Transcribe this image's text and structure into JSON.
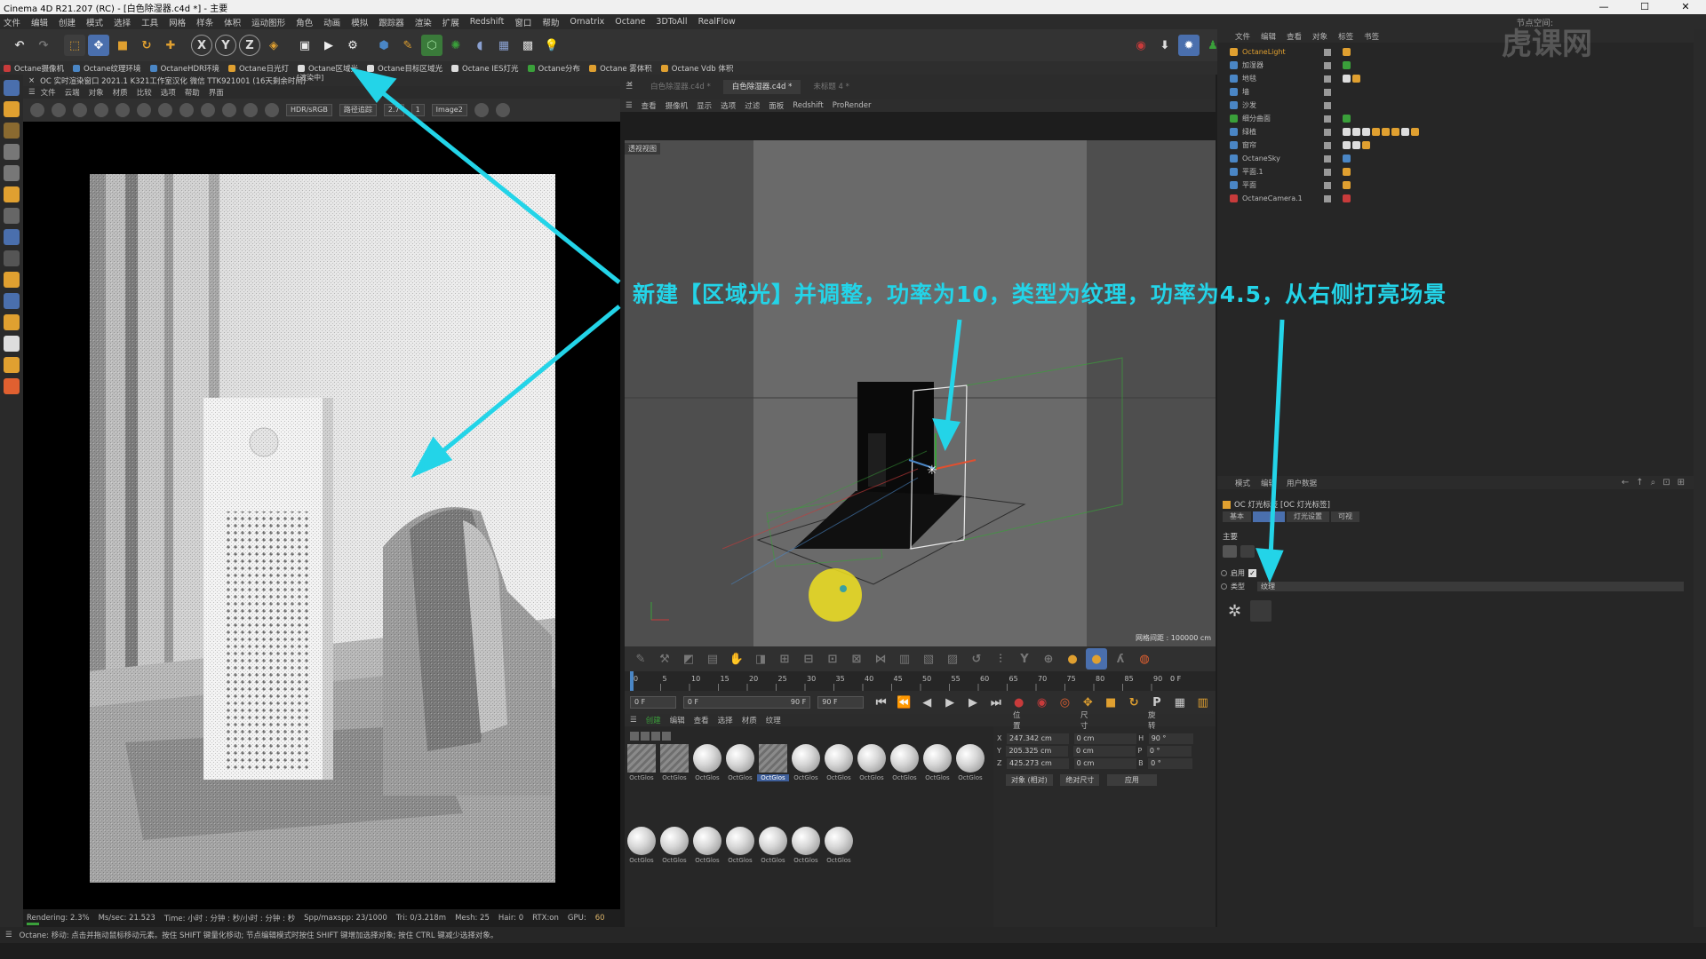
{
  "window": {
    "title": "Cinema 4D R21.207 (RC) - [白色除湿器.c4d *] - 主要",
    "controls": [
      "—",
      "☐",
      "✕"
    ]
  },
  "menubar": {
    "items": [
      "文件",
      "编辑",
      "创建",
      "模式",
      "选择",
      "工具",
      "网格",
      "样条",
      "体积",
      "运动图形",
      "角色",
      "动画",
      "模拟",
      "跟踪器",
      "渲染",
      "扩展",
      "Redshift",
      "窗口",
      "帮助",
      "Ornatrix",
      "Octane",
      "3DToAll",
      "RealFlow"
    ],
    "right_label": "节点空间:"
  },
  "toolbar": {
    "axis_labels": [
      "X",
      "Y",
      "Z"
    ]
  },
  "plugins": [
    {
      "label": "Octane摄像机",
      "color": "#c83b3b"
    },
    {
      "label": "Octane纹理环境",
      "color": "#4a86c5"
    },
    {
      "label": "OctaneHDR环境",
      "color": "#4a86c5"
    },
    {
      "label": "Octane日光灯",
      "color": "#e0a030"
    },
    {
      "label": "Octane区域光",
      "color": "#dddddd"
    },
    {
      "label": "Octane目标区域光",
      "color": "#dddddd"
    },
    {
      "label": "Octane IES灯光",
      "color": "#dddddd"
    },
    {
      "label": "Octane分布",
      "color": "#3aa03a"
    },
    {
      "label": "Octane 雾体积",
      "color": "#e0a030"
    },
    {
      "label": "Octane Vdb 体积",
      "color": "#e0a030"
    }
  ],
  "render_panel": {
    "tab_title": "OC 实时渲染窗口  2021.1  K321工作室汉化  微信  TTK921001 (16天剩余时间)",
    "menu": [
      "文件",
      "云端",
      "对象",
      "材质",
      "比较",
      "选项",
      "帮助",
      "界面"
    ],
    "status_badge": "[渲染中]",
    "color_space": "HDR/sRGB",
    "kernel": "路径追踪",
    "value_a": "2.7",
    "value_b": "1",
    "image_slot": "Image2",
    "status": {
      "rendering": "Rendering: 2.3%",
      "ms_sec": "Ms/sec: 21.523",
      "time": "Time: 小时 : 分钟 : 秒/小时 : 分钟 : 秒",
      "spp": "Spp/maxspp: 23/1000",
      "tri": "Tri: 0/3.218m",
      "mesh": "Mesh: 25",
      "hair": "Hair: 0",
      "rtx": "RTX:on",
      "gpu": "GPU:",
      "gpu_val": "60"
    },
    "progress": 0.023
  },
  "viewport": {
    "doc_tabs": [
      {
        "label": "白色除湿器.c4d *",
        "active": false
      },
      {
        "label": "白色除湿器.c4d *",
        "active": true
      },
      {
        "label": "未标题 4 *",
        "active": false
      }
    ],
    "menu": [
      "查看",
      "摄像机",
      "显示",
      "选项",
      "过滤",
      "面板",
      "Redshift",
      "ProRender"
    ],
    "label": "透视视图",
    "grid_scale": "网格间距 : 100000 cm"
  },
  "timeline": {
    "ticks": [
      "0",
      "5",
      "10",
      "15",
      "20",
      "25",
      "30",
      "35",
      "40",
      "45",
      "50",
      "55",
      "60",
      "65",
      "70",
      "75",
      "80",
      "85",
      "90"
    ],
    "end_label": "0 F",
    "current_frame": "0 F",
    "start_field": "0 F",
    "end_field": "90 F",
    "end_field2": "90 F"
  },
  "materials": {
    "menu": [
      "创建",
      "编辑",
      "查看",
      "选择",
      "材质",
      "纹理"
    ],
    "items": [
      {
        "name": "OctGlos",
        "type": "stripe"
      },
      {
        "name": "OctGlos",
        "type": "stripe"
      },
      {
        "name": "OctGlos",
        "type": "ball"
      },
      {
        "name": "OctGlos",
        "type": "ball"
      },
      {
        "name": "OctGlos",
        "type": "stripe",
        "selected": true
      },
      {
        "name": "OctGlos",
        "type": "ball"
      },
      {
        "name": "OctGlos",
        "type": "ball"
      },
      {
        "name": "OctGlos",
        "type": "ball"
      },
      {
        "name": "OctGlos",
        "type": "ball"
      },
      {
        "name": "OctGlos",
        "type": "ball"
      },
      {
        "name": "OctGlos",
        "type": "ball"
      },
      {
        "name": "OctGlos",
        "type": "ball"
      },
      {
        "name": "OctGlos",
        "type": "ball"
      },
      {
        "name": "OctGlos",
        "type": "ball"
      },
      {
        "name": "OctGlos",
        "type": "ball"
      },
      {
        "name": "OctGlos",
        "type": "ball"
      },
      {
        "name": "OctGlos",
        "type": "ball"
      },
      {
        "name": "OctGlos",
        "type": "ball"
      }
    ]
  },
  "coordinates": {
    "headers": [
      "位置",
      "尺寸",
      "旋转"
    ],
    "rows": [
      {
        "axis": "X",
        "pos": "247.342 cm",
        "size": "0 cm",
        "rot_axis": "H",
        "rot": "90 °"
      },
      {
        "axis": "Y",
        "pos": "205.325 cm",
        "size": "0 cm",
        "rot_axis": "P",
        "rot": "0 °"
      },
      {
        "axis": "Z",
        "pos": "425.273 cm",
        "size": "0 cm",
        "rot_axis": "B",
        "rot": "0 °"
      }
    ],
    "mode": "对象 (相对)",
    "size_mode": "绝对尺寸",
    "apply": "应用"
  },
  "object_manager": {
    "menu": [
      "文件",
      "编辑",
      "查看",
      "对象",
      "标签",
      "书签"
    ],
    "objects": [
      {
        "name": "OctaneLight",
        "color": "#e0a030",
        "highlight": true
      },
      {
        "name": "加湿器",
        "color": "#4a86c5"
      },
      {
        "name": "地毯",
        "color": "#4a86c5"
      },
      {
        "name": "墙",
        "color": "#4a86c5"
      },
      {
        "name": "沙发",
        "color": "#4a86c5"
      },
      {
        "name": "细分曲面",
        "color": "#3aa03a"
      },
      {
        "name": "绿植",
        "color": "#4a86c5"
      },
      {
        "name": "窗帘",
        "color": "#4a86c5"
      },
      {
        "name": "OctaneSky",
        "color": "#4a86c5"
      },
      {
        "name": "平面.1",
        "color": "#4a86c5"
      },
      {
        "name": "平面",
        "color": "#4a86c5"
      },
      {
        "name": "OctaneCamera.1",
        "color": "#c83b3b"
      }
    ]
  },
  "attributes": {
    "menu": [
      "模式",
      "编辑",
      "用户数据"
    ],
    "title": "OC 灯光标签 [OC 灯光标签]",
    "tabs": [
      {
        "label": "基本",
        "active": false
      },
      {
        "label": "",
        "active": true
      },
      {
        "label": "灯光设置",
        "active": false
      },
      {
        "label": "可视",
        "active": false
      }
    ],
    "section": "主要",
    "enable_label": "启用",
    "type_label": "类型",
    "type_value": "纹理"
  },
  "statusbar": {
    "text": "Octane:    移动: 点击并拖动鼠标移动元素。按住 SHIFT 键量化移动; 节点编辑模式时按住 SHIFT 键增加选择对象; 按住 CTRL 键减少选择对象。"
  },
  "annotation": {
    "text": "新建【区域光】并调整，功率为10，类型为纹理，功率为4.5，从右侧打亮场景",
    "color": "#23d4e8"
  },
  "watermark": {
    "text": "虎课网"
  }
}
